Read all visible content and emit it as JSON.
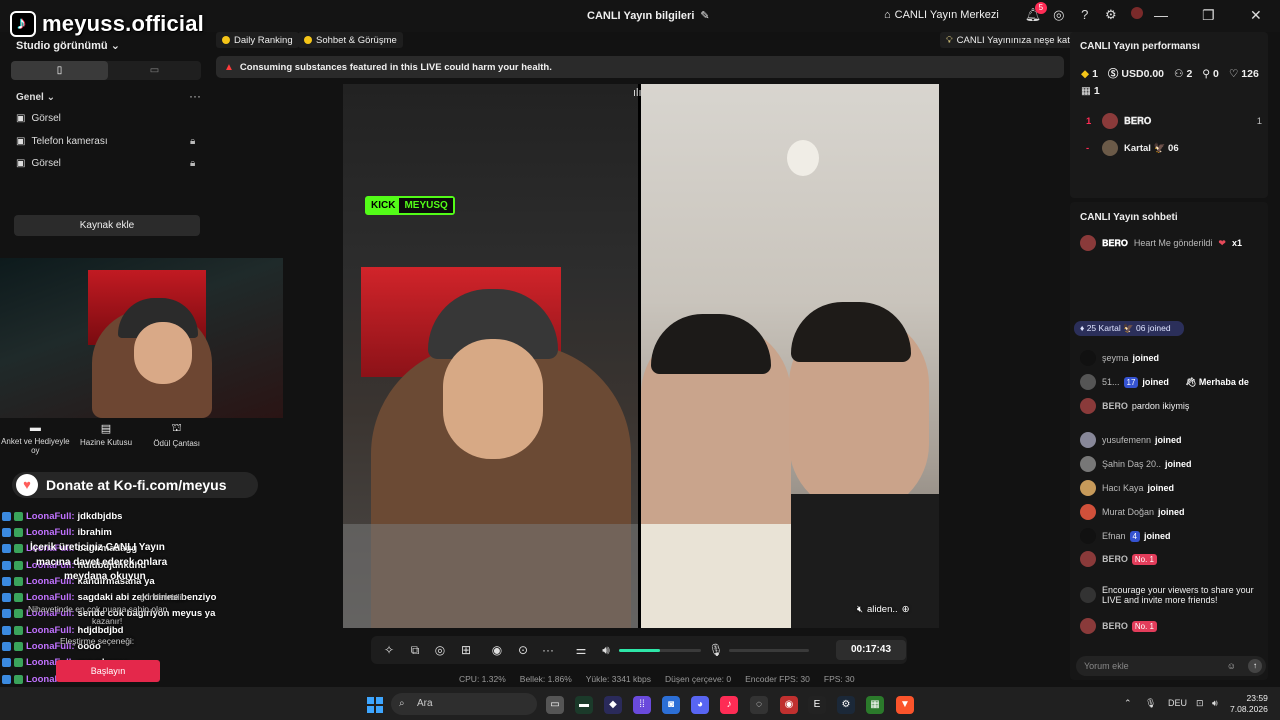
{
  "app": {
    "channel_name": "meyuss.official",
    "title": "CANLI Yayın bilgileri",
    "live_center": "CANLI Yayın Merkezi",
    "notif_count": "5"
  },
  "left": {
    "studio_view": "Studio görünümü",
    "section": "Genel",
    "sources": [
      {
        "label": "Görsel",
        "locked": false
      },
      {
        "label": "Telefon kamerası",
        "locked": true
      },
      {
        "label": "Görsel",
        "locked": true
      }
    ],
    "add_source": "Kaynak ekle",
    "tools": [
      {
        "label": "Anket ve Hediyeyle oy",
        "icon": "poll-icon"
      },
      {
        "label": "Hazine Kutusu",
        "icon": "treasure-icon"
      },
      {
        "label": "Ödül Çantası",
        "icon": "reward-bag-icon"
      }
    ],
    "donate": "Donate at Ko-fi.com/meyus",
    "overlay_chat": [
      {
        "user": "LoonaFull:",
        "message": "jdkdbjdbs"
      },
      {
        "user": "LoonaFull:",
        "message": "ibrahim"
      },
      {
        "user": "LoonaFull:",
        "message": "bagirmadagg"
      },
      {
        "user": "LoonaFull:",
        "message": "hdidbdjdhkdhd"
      },
      {
        "user": "LoonaFull:",
        "message": "kandirmasana ya"
      },
      {
        "user": "LoonaFull:",
        "message": "sagdaki abi zeki birine benziyo"
      },
      {
        "user": "LoonaFull:",
        "message": "sende cok bagiriyon meyus ya"
      },
      {
        "user": "LoonaFull:",
        "message": "hdjdbdjbd"
      },
      {
        "user": "LoonaFull:",
        "message": "oooo"
      },
      {
        "user": "LoonaFull:",
        "message": "meyabaaaa"
      },
      {
        "user": "LoonaFull:",
        "message": ""
      }
    ],
    "overlay_texts": {
      "line1": "İçerik üreticiniz CANLI Yayın",
      "line2": "macına davet ederek onlara",
      "line3": "meydana okuyun",
      "line4": "Nihayetinde en çok puana sahip olan",
      "line5": "kazanır!",
      "line6": "Eleştirme seçeneği:",
      "line7": "gönderebilir."
    },
    "start_button": "Başlayın"
  },
  "center": {
    "tags": [
      "Daily Ranking",
      "Sohbet & Görüşme"
    ],
    "join_tag": "CANLI Yayınınıza neşe katın",
    "warning": "Consuming substances featured in this LIVE could harm your health.",
    "overlay_kick": "KICK",
    "overlay_name": "MEYUSQ",
    "guest_name": "aliden..",
    "timer": "00:17:43",
    "volume_level": 0.5,
    "stats": [
      "CPU: 1.32%",
      "Bellek: 1.86%",
      "Yükle: 3341 kbps",
      "Düşen çerçeve: 0",
      "Encoder FPS: 30",
      "FPS: 30"
    ]
  },
  "right": {
    "perf_title": "CANLI Yayın performansı",
    "perf": {
      "diamonds": "1",
      "usd": "USD0.00",
      "viewers": "2",
      "new_followers": "0",
      "likes": "126",
      "gifts": "1"
    },
    "ranking": [
      {
        "rank": "1",
        "name": "𝐁𝐄𝐑𝐎",
        "score": "1"
      },
      {
        "rank": "-",
        "name": "Kartal 🦅 06",
        "score": ""
      }
    ],
    "chat_title": "CANLI Yayın sohbeti",
    "gift_msg": {
      "user": "𝐁𝐄𝐑𝐎",
      "text": "Heart Me gönderildi",
      "count": "x1"
    },
    "join_banner": {
      "level": "25",
      "text": "Kartal 🦅 06 joined"
    },
    "messages": [
      {
        "name": "şeyma",
        "text": "joined"
      },
      {
        "name": "51...",
        "badge": "17",
        "text": "joined",
        "extra": "Merhaba de"
      },
      {
        "name": "𝐁𝐄𝐑𝐎",
        "text": "pardon ikiymiş"
      },
      {
        "name": "yusufemenn",
        "text": "joined"
      },
      {
        "name": "Şahin Daş 20..",
        "text": "joined"
      },
      {
        "name": "Hacı Kaya",
        "text": "joined"
      },
      {
        "name": "Murat Doğan",
        "text": "joined"
      },
      {
        "name": "Efnan",
        "badge": "4",
        "text": "joined"
      },
      {
        "name": "𝐁𝐄𝐑𝐎",
        "badge": "No. 1",
        "text": ""
      },
      {
        "name": "",
        "text": "Encourage your viewers to share your LIVE and invite more friends!"
      },
      {
        "name": "𝐁𝐄𝐑𝐎",
        "badge": "No. 1",
        "text": ""
      }
    ],
    "comment_placeholder": "Yorum ekle"
  },
  "taskbar": {
    "search": "Ara",
    "lang": "DEU",
    "time": "23:59",
    "date": "7.08.2026"
  }
}
